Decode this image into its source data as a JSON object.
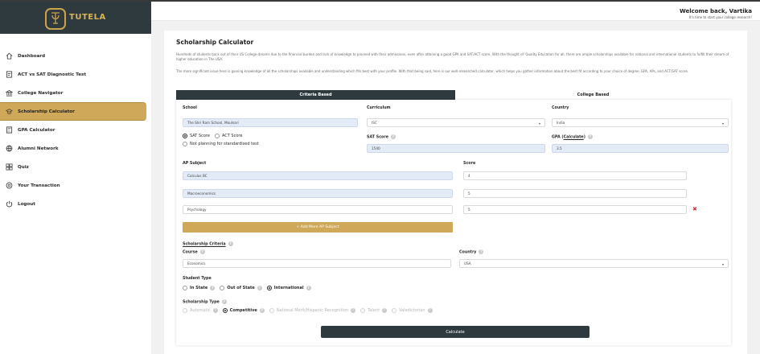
{
  "brand": {
    "name": "TUTELA"
  },
  "sidebar": {
    "items": [
      {
        "label": "Dashboard",
        "icon": "home-icon",
        "active": false
      },
      {
        "label": "ACT vs SAT Diagnostic Test",
        "icon": "test-icon",
        "active": false
      },
      {
        "label": "College Navigator",
        "icon": "college-icon",
        "active": false
      },
      {
        "label": "Scholarship Calculator",
        "icon": "scholarship-icon",
        "active": true
      },
      {
        "label": "GPA Calculator",
        "icon": "calculator-icon",
        "active": false
      },
      {
        "label": "Alumni Network",
        "icon": "globe-icon",
        "active": false
      },
      {
        "label": "Quiz",
        "icon": "quiz-icon",
        "active": false
      },
      {
        "label": "Your Transaction",
        "icon": "transaction-icon",
        "active": false
      },
      {
        "label": "Logout",
        "icon": "power-icon",
        "active": false
      }
    ]
  },
  "header": {
    "welcome": "Welcome back, Vartika",
    "subtitle": "It's time to start your college research!"
  },
  "main": {
    "title": "Scholarship Calculator",
    "para1": "Hundreds of students back out of their US College dreams due to the financial burden and lack of knowledge to proceed with their admissions, even after attaining a good GPA and SAT/ACT score. With the thought of 'Quality Education for all, there are ample scholarships available for national and international students to fulfill their dream of higher education in The USA.",
    "para2": "The more significant issue here is gaining knowledge of all the scholarships available and understanding which fits best with your profile. With that being said, here is our well-researched calculator, which helps you gather information about the best fit according to your choice of degree, GPA, APs, and ACT/SAT score.",
    "tabs": [
      "Criteria Based",
      "College Based"
    ]
  },
  "form": {
    "school_label": "School",
    "school_value": "The Shri Ram School, Moulsari",
    "curriculum_label": "Curriculum",
    "curriculum_value": "ISC",
    "country_label": "Country",
    "country_value": "India",
    "test_options": [
      "SAT Score",
      "ACT Score",
      "Not planning for standardised test"
    ],
    "test_selected": "SAT Score",
    "sat_label": "SAT Score",
    "sat_value": "1540",
    "gpa_label_pre": "GPA (",
    "gpa_label_link": "Calculate",
    "gpa_label_post": ")",
    "gpa_value": "3.5",
    "ap_subject_label": "AP Subject",
    "score_label": "Score",
    "ap_rows": [
      {
        "subject": "Calculus BC",
        "score": "4"
      },
      {
        "subject": "Macroeconomics",
        "score": "5"
      },
      {
        "subject": "Psychology",
        "score": "5"
      }
    ],
    "add_ap_label": "+ Add More AP Subject",
    "criteria_heading": "Scholarship Criteria",
    "course_label": "Course",
    "course_value": "Economics",
    "study_country_label": "Country",
    "study_country_value": "USA",
    "student_type_label": "Student Type",
    "student_types": [
      "In State",
      "Out of State",
      "International"
    ],
    "student_type_selected": "International",
    "scholarship_type_label": "Scholarship Type",
    "scholarship_types": [
      "Automatic",
      "Competitive",
      "National Merit/Hispanic Recognition",
      "Talent",
      "Valedictorian"
    ],
    "scholarship_type_selected": "Competitive",
    "calculate_label": "Calculate",
    "help_glyph": "?",
    "caret_glyph": "▾",
    "remove_glyph": "✖"
  },
  "colors": {
    "accent": "#cfa85a",
    "dark": "#2f3a3f",
    "field_blue": "#e3ebf8",
    "remove_red": "#d63a3a"
  }
}
